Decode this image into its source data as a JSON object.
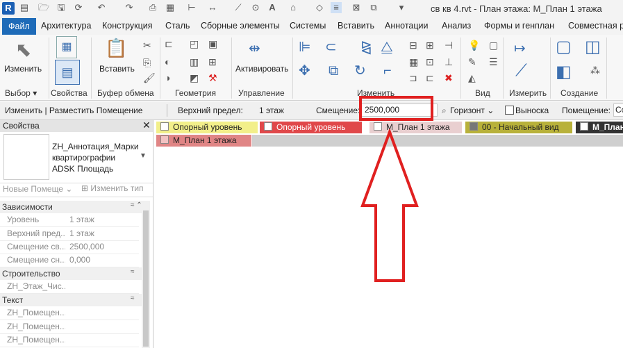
{
  "title_bar": {
    "logo": "R",
    "title": "св кв 4.rvt - План этажа: М_План 1 этажа",
    "quick_access_icons": [
      "open-icon",
      "save-icon",
      "sync-icon",
      "undo-icon",
      "redo-icon",
      "print-icon",
      "measure-icon",
      "dimension-icon",
      "text-icon",
      "home-icon",
      "view-icon",
      "switch-window-icon"
    ]
  },
  "tabs": [
    "Файл",
    "Архитектура",
    "Конструкция",
    "Сталь",
    "Сборные элементы",
    "Системы",
    "Вставить",
    "Аннотации",
    "Анализ",
    "Формы и генплан",
    "Совместная ра"
  ],
  "ribbon": {
    "modify_label": "Изменить",
    "properties_label": "Свойства",
    "paste_label": "Вставить",
    "activate_label": "Активировать",
    "panels": [
      "Выбор",
      "Свойства",
      "Буфер обмена",
      "Геометрия",
      "Управление",
      "Изменить",
      "Вид",
      "Измерить",
      "Создание"
    ]
  },
  "options_bar": {
    "context": "Изменить | Разместить Помещение",
    "upper_limit_label": "Верхний предел:",
    "upper_limit_value": "1 этаж",
    "offset_label": "Смещение:",
    "offset_value": "2500,000",
    "orientation_value": "Горизонт",
    "leader_label": "Выноска",
    "room_label": "Помещение:",
    "room_value": "Со"
  },
  "properties": {
    "header": "Свойства",
    "type_name": "ZH_Аннотация_Марки квартирографии ADSK Площадь",
    "new_room_label": "Новые Помеще",
    "edit_type_label": "Изменить тип",
    "groups": [
      {
        "name": "Зависимости",
        "rows": [
          {
            "key": "Уровень",
            "value": "1 этаж"
          },
          {
            "key": "Верхний пред...",
            "value": "1 этаж"
          },
          {
            "key": "Смещение св...",
            "value": "2500,000"
          },
          {
            "key": "Смещение сн...",
            "value": "0,000"
          }
        ]
      },
      {
        "name": "Строительство",
        "rows": [
          {
            "key": "ZH_Этаж_Чис...",
            "value": ""
          }
        ]
      },
      {
        "name": "Текст",
        "rows": [
          {
            "key": "ZH_Помещен...",
            "value": ""
          },
          {
            "key": "ZH_Помещен...",
            "value": ""
          },
          {
            "key": "ZH_Помещен...",
            "value": ""
          }
        ]
      }
    ]
  },
  "view_tabs": [
    {
      "label": "Опорный уровень",
      "color": "#f2ef8a"
    },
    {
      "label": "Опорный уровень",
      "color": "#e0484a"
    },
    {
      "label": "М_План 1 этажа",
      "color": "#e9cfd0"
    },
    {
      "label": "00 - Начальный вид",
      "color": "#b8b13a"
    },
    {
      "label": "М_План",
      "color": "#333333"
    },
    {
      "label": "М_План 1 этажа",
      "color": "#e08585"
    }
  ],
  "annotation": {
    "color": "#e02020"
  }
}
